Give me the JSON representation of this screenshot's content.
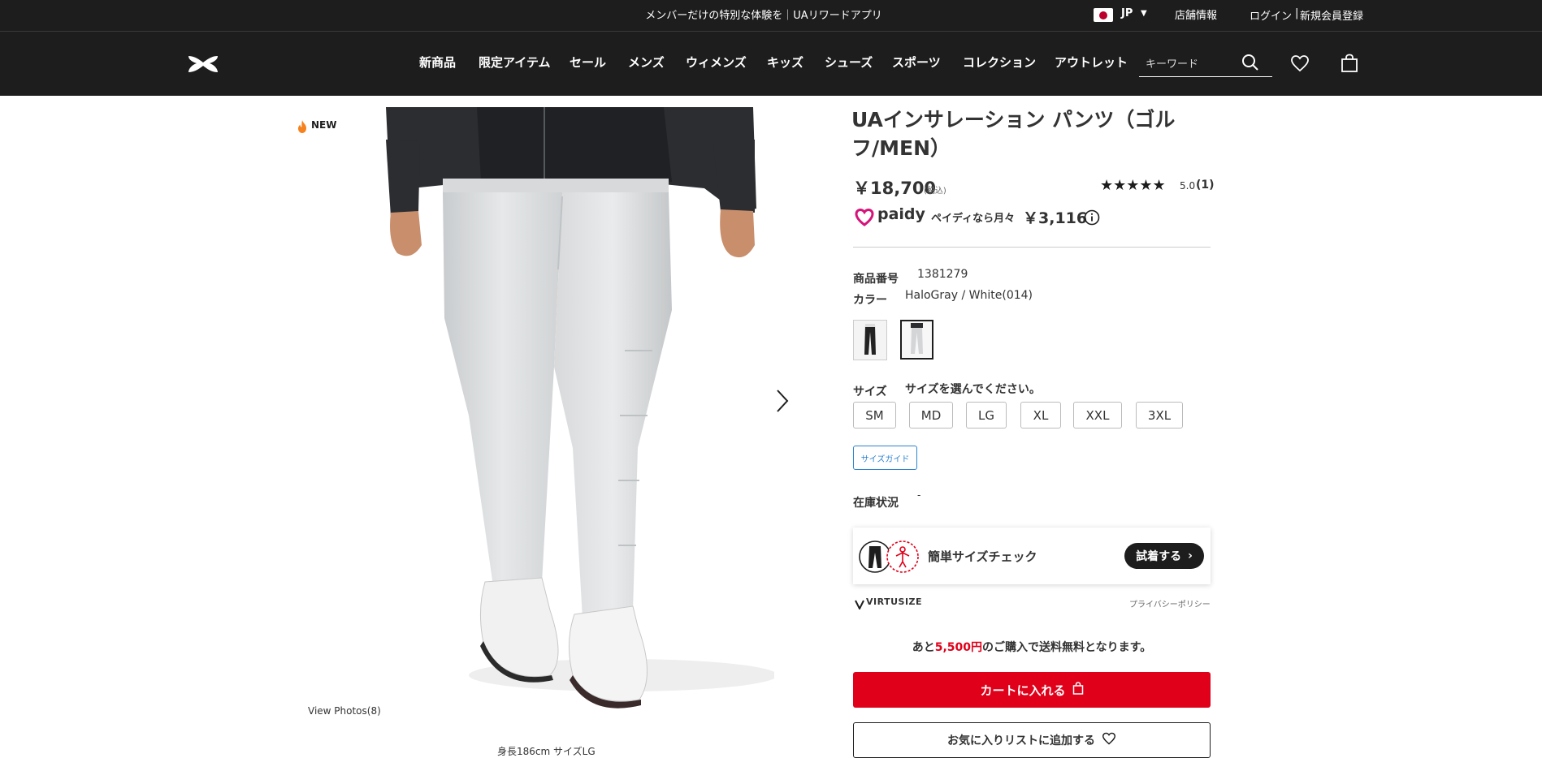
{
  "topbar": {
    "promo": "メンバーだけの特別な体験を｜UAリワードアプリ",
    "country": "JP",
    "stores": "店舗情報",
    "login": "ログイン",
    "separator": "|",
    "register": "新規会員登録"
  },
  "nav": {
    "items": [
      "新商品",
      "限定アイテム",
      "セール",
      "メンズ",
      "ウィメンズ",
      "キッズ",
      "シューズ",
      "スポーツ",
      "コレクション",
      "アウトレット"
    ],
    "search_placeholder": "キーワード"
  },
  "gallery": {
    "badge": "NEW",
    "view_photos": "View Photos(8)",
    "model_info": "身長186cm サイズLG"
  },
  "product": {
    "title": "UAインサレーション パンツ（ゴルフ/MEN）",
    "price": "￥18,700",
    "tax_note": "(税込)",
    "stars": "★★★★★",
    "rating": "5.0",
    "review_count": "(1)",
    "paidy_brand": "paidy",
    "paidy_text": "ペイディなら月々",
    "paidy_amount": "￥3,116",
    "sku_label": "商品番号",
    "sku": "1381279",
    "color_label": "カラー",
    "color": "HaloGray / White(014)",
    "size_label": "サイズ",
    "size_prompt": "サイズを選んでください。",
    "sizes": [
      "SM",
      "MD",
      "LG",
      "XL",
      "XXL",
      "3XL"
    ],
    "size_guide": "サイズガイド",
    "stock_label": "在庫状況",
    "stock_value": "-"
  },
  "virtusize": {
    "label": "簡単サイズチェック",
    "try_button": "試着する",
    "brand": "VIRTUSIZE",
    "privacy": "プライバシーポリシー"
  },
  "shipping": {
    "prefix": "あと",
    "amount": "5,500円",
    "suffix": "のご購入で送料無料となります。"
  },
  "actions": {
    "add_to_cart": "カートに入れる",
    "add_to_wishlist": "お気に入りリストに追加する"
  },
  "colors": {
    "dark": "#1d1d1d",
    "accent_red": "#e0001a",
    "link_blue": "#2c83d0"
  }
}
